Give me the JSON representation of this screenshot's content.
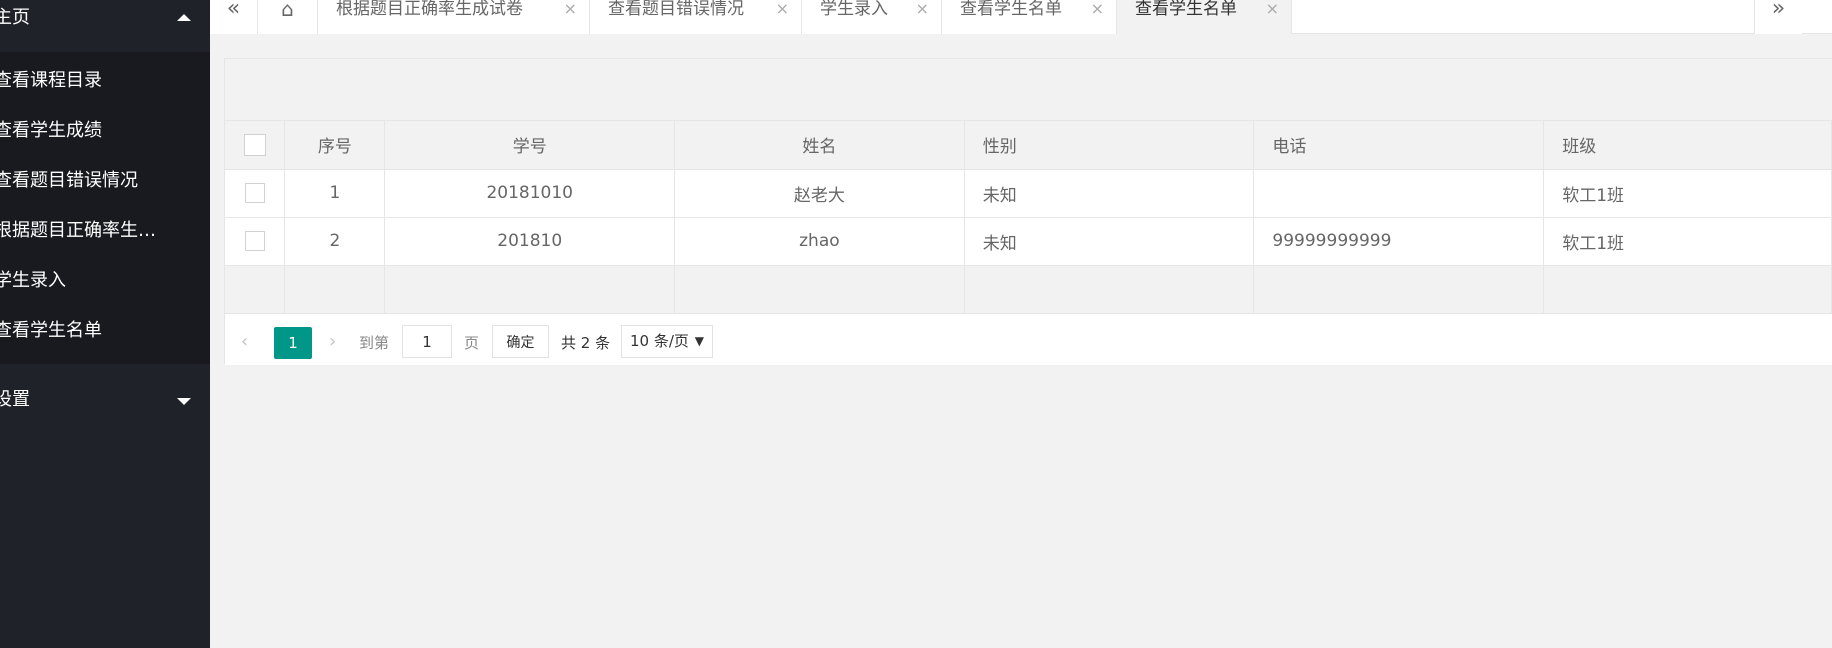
{
  "sidebar": {
    "home_label": "主页",
    "items": [
      {
        "label": "查看课程目录"
      },
      {
        "label": "查看学生成绩"
      },
      {
        "label": "查看题目错误情况"
      },
      {
        "label": "根据题目正确率生成试卷"
      },
      {
        "label": "学生录入"
      },
      {
        "label": "查看学生名单"
      }
    ],
    "settings_label": "设置"
  },
  "tabs": [
    {
      "label": "根据题目正确率生成试卷"
    },
    {
      "label": "查看题目错误情况"
    },
    {
      "label": "学生录入"
    },
    {
      "label": "查看学生名单"
    },
    {
      "label": "查看学生名单"
    }
  ],
  "icons": {
    "tab_prev": "«",
    "home": "⌂",
    "tab_close": "×",
    "tab_next": "»",
    "page_prev": "‹",
    "page_next": "›"
  },
  "table": {
    "headers": [
      "序号",
      "学号",
      "姓名",
      "性别",
      "电话",
      "班级"
    ],
    "rows": [
      {
        "no": "1",
        "sid": "20181010",
        "name": "赵老大",
        "gender": "未知",
        "phone": "",
        "class": "软工1班"
      },
      {
        "no": "2",
        "sid": "201810",
        "name": "zhao",
        "gender": "未知",
        "phone": "99999999999",
        "class": "软工1班"
      }
    ]
  },
  "pager": {
    "current": "1",
    "goto_label": "到第",
    "page_input": "1",
    "page_unit": "页",
    "confirm_label": "确定",
    "total": "共 2 条",
    "page_size": "10 条/页"
  },
  "colors": {
    "sidebar_bg": "#20222a",
    "accent": "#009688"
  }
}
